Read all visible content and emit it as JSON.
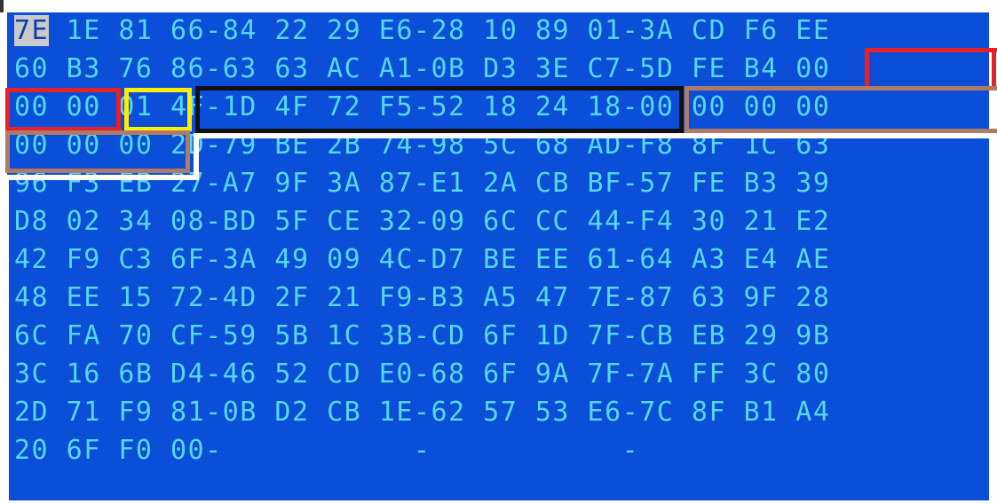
{
  "hex_view": {
    "cursor_byte": "7E",
    "rows": [
      " 1E 81 66-84 22 29 E6-28 10 89 01-3A CD F6 EE",
      "60 B3 76 86-63 63 AC A1-0B D3 3E C7-5D FE B4 00",
      "00 00 01 4F-1D 4F 72 F5-52 18 24 18-00 00 00 00",
      "00 00 00 2D-79 BE 2B 74-98 5C 68 AD-F8 8F 1C 63",
      "96 F3 EB 27-A7 9F 3A 87-E1 2A CB BF-57 FE B3 39",
      "D8 02 34 08-BD 5F CE 32-09 6C CC 44-F4 30 21 E2",
      "42 F9 C3 6F-3A 49 09 4C-D7 BE EE 61-64 A3 E4 AE",
      "48 EE 15 72-4D 2F 21 F9-B3 A5 47 7E-87 63 9F 28",
      "6C FA 70 CF-59 5B 1C 3B-CD 6F 1D 7F-CB EB 29 9B",
      "3C 16 6B D4-46 52 CD E0-68 6F 9A 7F-7A FF 3C 80",
      "2D 71 F9 81-0B D2 CB 1E-62 57 53 E6-7C 8F B1 A4",
      "20 6F F0 00-           -           -"
    ]
  },
  "annotation_colors": {
    "red": "#e8202a",
    "yellow": "#ffee00",
    "black": "#111111",
    "brown": "#b07a66",
    "white": "#ffffff",
    "background": "#0b4fd8",
    "text": "#55d7ee"
  }
}
